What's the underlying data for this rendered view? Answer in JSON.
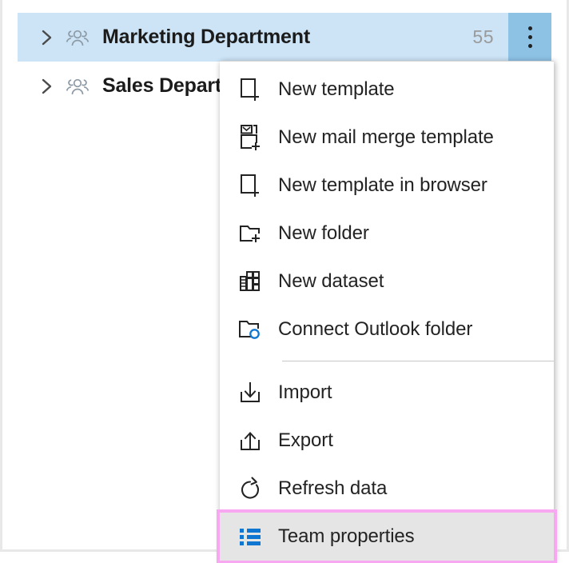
{
  "tree": {
    "rows": [
      {
        "name": "marketing-department",
        "label": "Marketing Department",
        "count": "55",
        "selected": true,
        "expand_icon": "chevron-right-icon",
        "entity_icon": "people-group-icon",
        "has_kebab": true,
        "kebab_icon": "more-options-vertical-icon"
      },
      {
        "name": "sales-department",
        "label": "Sales Department",
        "count": "",
        "selected": false,
        "expand_icon": "chevron-right-icon",
        "entity_icon": "people-group-icon",
        "has_kebab": false,
        "kebab_icon": ""
      }
    ]
  },
  "context_menu": {
    "items": [
      {
        "name": "new-template",
        "label": "New template",
        "icon": "new-document-plus-icon",
        "separator_after": false,
        "hovered": false
      },
      {
        "name": "new-mail-merge-template",
        "label": "New mail merge template",
        "icon": "mail-merge-document-plus-icon",
        "separator_after": false,
        "hovered": false
      },
      {
        "name": "new-template-in-browser",
        "label": "New template in browser",
        "icon": "new-document-plus-icon",
        "separator_after": false,
        "hovered": false
      },
      {
        "name": "new-folder",
        "label": "New folder",
        "icon": "new-folder-plus-icon",
        "separator_after": false,
        "hovered": false
      },
      {
        "name": "new-dataset",
        "label": "New dataset",
        "icon": "dataset-grid-icon",
        "separator_after": false,
        "hovered": false
      },
      {
        "name": "connect-outlook-folder",
        "label": "Connect Outlook folder",
        "icon": "outlook-folder-icon",
        "separator_after": true,
        "hovered": false
      },
      {
        "name": "import",
        "label": "Import",
        "icon": "import-download-icon",
        "separator_after": false,
        "hovered": false
      },
      {
        "name": "export",
        "label": "Export",
        "icon": "export-upload-icon",
        "separator_after": false,
        "hovered": false
      },
      {
        "name": "refresh-data",
        "label": "Refresh data",
        "icon": "refresh-circular-arrow-icon",
        "separator_after": false,
        "hovered": false
      },
      {
        "name": "team-properties",
        "label": "Team properties",
        "icon": "properties-list-icon",
        "separator_after": false,
        "hovered": true
      }
    ]
  },
  "colors": {
    "selection_blue": "#cce4f6",
    "kebab_active_blue": "#8ec2e5",
    "highlight_pink": "#f7a8f0",
    "hover_gray": "#e5e5e5",
    "accent_blue": "#0f77d1",
    "text_dark": "#232323",
    "count_gray": "#9a9a9a"
  }
}
